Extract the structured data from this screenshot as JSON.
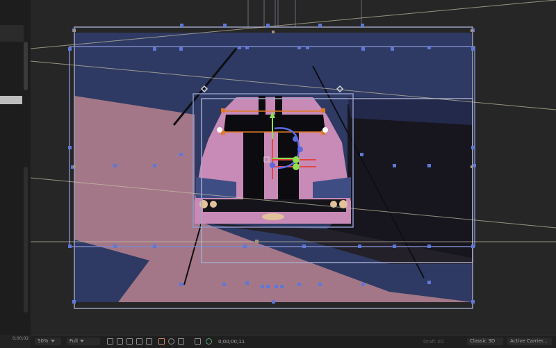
{
  "panel": {
    "time": "0;00;02"
  },
  "statusbar": {
    "zoom": "50%",
    "resolution": "Full",
    "timecode": "0;00;00;11",
    "draft3d": "Draft 3D",
    "renderer": "Classic 3D",
    "camera": "Active Carrier..."
  },
  "colors": {
    "sky": "#2e3a63",
    "road_pink": "#a37788",
    "car_pink": "#c88ab6",
    "dark": "#16151d",
    "handle_blue": "#5f77d6",
    "guide": "#c9c2a5"
  },
  "icons": [
    "camera-icon",
    "grid-icon",
    "mask-icon",
    "color-icon",
    "snapshot-icon",
    "region-icon",
    "transparency-icon",
    "3d-icon"
  ]
}
